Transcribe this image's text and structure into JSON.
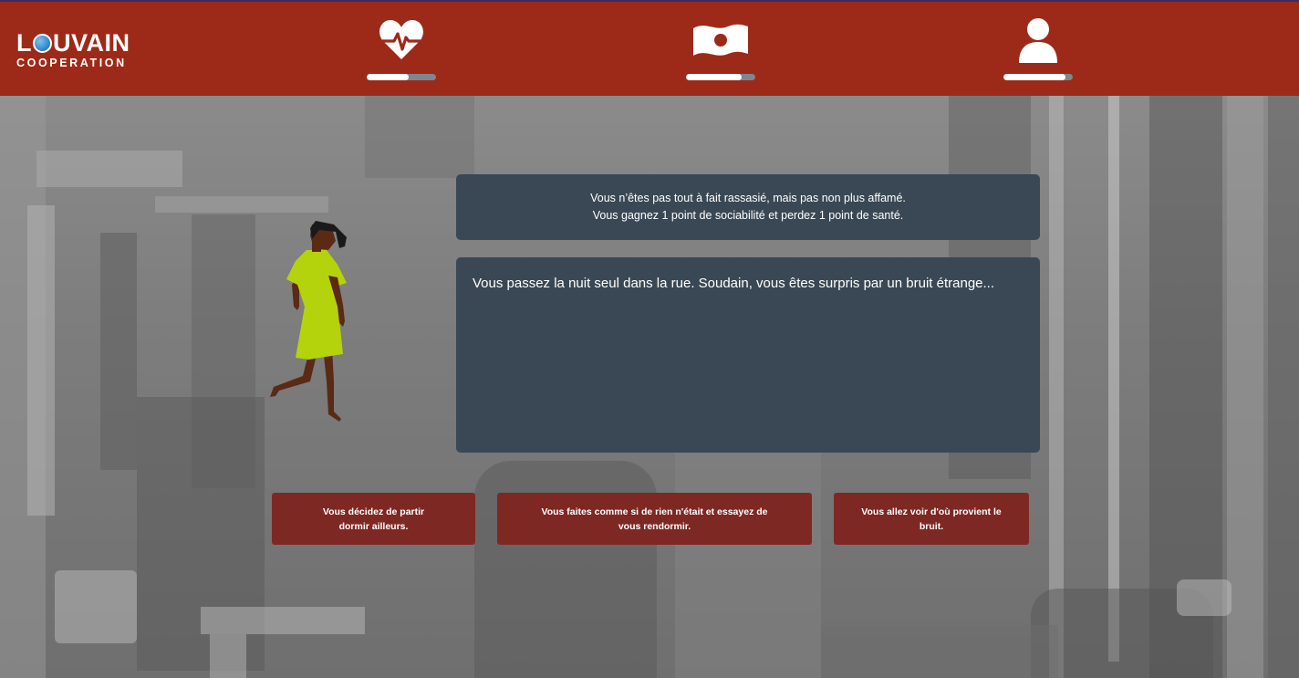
{
  "header": {
    "logo": {
      "main_before": "L",
      "main_after": "UVAIN",
      "sub": "COOPERATION"
    },
    "stats": [
      {
        "name": "health",
        "icon": "heart-pulse-icon",
        "level": 0.6
      },
      {
        "name": "money",
        "icon": "banknote-icon",
        "level": 0.8
      },
      {
        "name": "sociability",
        "icon": "person-icon",
        "level": 0.9
      }
    ],
    "colors": {
      "background": "#9d2a18",
      "bar_track": "#7f8591",
      "bar_fill": "#ffffff"
    }
  },
  "feedback": {
    "line1": "Vous n’êtes pas tout à fait rassasié, mais pas non plus affamé.",
    "line2": "Vous gagnez 1 point de sociabilité et perdez 1 point de santé."
  },
  "story": {
    "text": "Vous passez la nuit seul dans la rue. Soudain, vous êtes surpris par un bruit étrange..."
  },
  "choices": [
    {
      "label": "Vous décidez de partir dormir ailleurs."
    },
    {
      "label": "Vous faites comme si de rien n'était et essayez de vous rendormir."
    },
    {
      "label": "Vous allez voir d'où provient le bruit."
    }
  ],
  "colors": {
    "panel": "#394854",
    "choice": "#7e2824",
    "character_dress": "#b5d30c",
    "character_skin": "#5a2a14"
  }
}
